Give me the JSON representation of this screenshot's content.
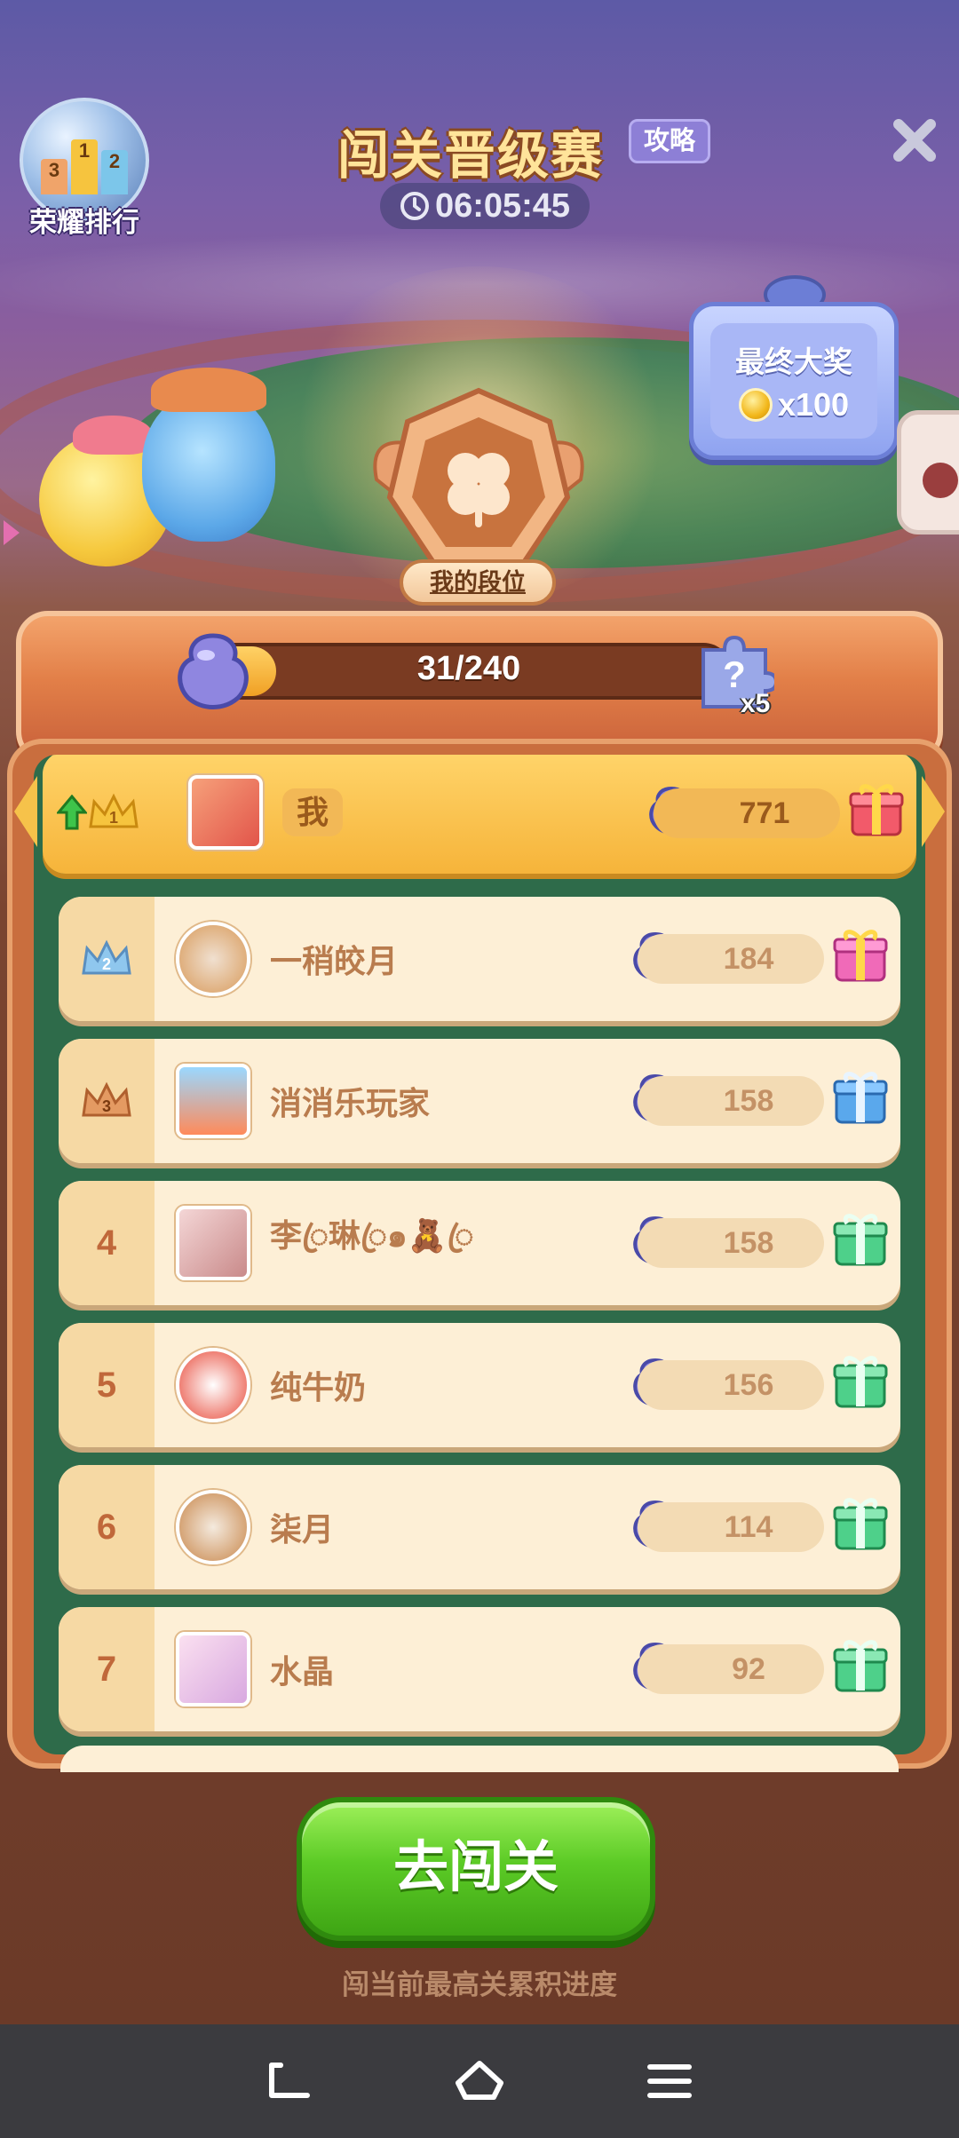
{
  "header": {
    "honor_rank_label": "荣耀排行",
    "podium_numbers": [
      "3",
      "1",
      "2"
    ],
    "title": "闯关晋级赛",
    "guide_label": "攻略",
    "timer": "06:05:45"
  },
  "final_prize": {
    "title": "最终大奖",
    "amount": "x100"
  },
  "my_rank_label": "我的段位",
  "progress": {
    "text": "31/240",
    "fraction": 0.129,
    "mystery_icon_text": "?",
    "mystery_multiplier": "x5"
  },
  "leaderboard": [
    {
      "rank": "1",
      "name": "我",
      "score": "771",
      "is_me": true
    },
    {
      "rank": "2",
      "name": "一稍皎月",
      "score": "184"
    },
    {
      "rank": "3",
      "name": "消消乐玩家",
      "score": "158"
    },
    {
      "rank": "4",
      "name": "李ꦿ琳ꦿ๑🧸ꦿ",
      "score": "158"
    },
    {
      "rank": "5",
      "name": "纯牛奶",
      "score": "156"
    },
    {
      "rank": "6",
      "name": "柒月",
      "score": "114"
    },
    {
      "rank": "7",
      "name": "水晶",
      "score": "92"
    }
  ],
  "cta": {
    "button_label": "去闯关",
    "hint": "闯当前最高关累积进度"
  },
  "colors": {
    "gold_crown": "#f6c43e",
    "silver_crown": "#8fc7ee",
    "bronze_crown": "#e49a62",
    "gift_rank1": "#f25a6a",
    "gift_rank2": "#f06ab8",
    "gift_rank3": "#5aa8ec",
    "gift_other": "#4ed08a"
  },
  "icons": {
    "close": "close-icon",
    "clock": "clock-icon",
    "gem": "gem-icon",
    "gift": "gift-icon",
    "crown": "crown-icon",
    "coin": "coin-icon",
    "nav_back": "back-icon",
    "nav_home": "home-icon",
    "nav_menu": "menu-icon"
  }
}
